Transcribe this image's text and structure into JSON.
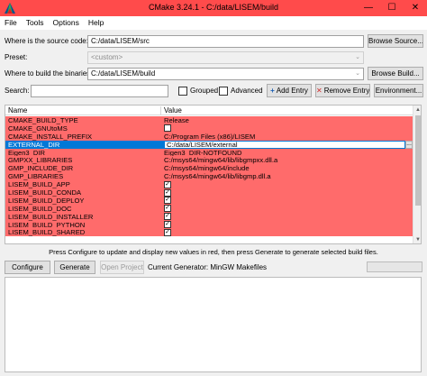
{
  "window": {
    "title": "CMake 3.24.1 - C:/data/LISEM/build",
    "controls": [
      "—",
      "☐",
      "✕"
    ]
  },
  "menu": [
    "File",
    "Tools",
    "Options",
    "Help"
  ],
  "source": {
    "label": "Where is the source code:",
    "value": "C:/data/LISEM/src",
    "browse": "Browse Source..."
  },
  "preset": {
    "label": "Preset:",
    "value": "<custom>"
  },
  "binaries": {
    "label": "Where to build the binaries:",
    "value": "C:/data/LISEM/build",
    "browse": "Browse Build..."
  },
  "search": {
    "label": "Search:",
    "value": "",
    "grouped": "Grouped",
    "advanced": "Advanced",
    "add_entry": "Add Entry",
    "remove_entry": "Remove Entry",
    "environment": "Environment..."
  },
  "table": {
    "headers": {
      "name": "Name",
      "value": "Value"
    },
    "rows": [
      {
        "name": "CMAKE_BUILD_TYPE",
        "value": "Release"
      },
      {
        "name": "CMAKE_GNUtoMS",
        "value": "",
        "checkbox": false
      },
      {
        "name": "CMAKE_INSTALL_PREFIX",
        "value": "C:/Program Files (x86)/LISEM"
      },
      {
        "name": "EXTERNAL_DIR",
        "value": "C:/data/LISEM/external",
        "selected": true
      },
      {
        "name": "Eigen3_DIR",
        "value": "Eigen3_DIR-NOTFOUND"
      },
      {
        "name": "GMPXX_LIBRARIES",
        "value": "C:/msys64/mingw64/lib/libgmpxx.dll.a"
      },
      {
        "name": "GMP_INCLUDE_DIR",
        "value": "C:/msys64/mingw64/include"
      },
      {
        "name": "GMP_LIBRARIES",
        "value": "C:/msys64/mingw64/lib/libgmp.dll.a"
      },
      {
        "name": "LISEM_BUILD_APP",
        "value": "",
        "checkbox": true
      },
      {
        "name": "LISEM_BUILD_CONDA",
        "value": "",
        "checkbox": true
      },
      {
        "name": "LISEM_BUILD_DEPLOY",
        "value": "",
        "checkbox": true
      },
      {
        "name": "LISEM_BUILD_DOC",
        "value": "",
        "checkbox": true
      },
      {
        "name": "LISEM_BUILD_INSTALLER",
        "value": "",
        "checkbox": true
      },
      {
        "name": "LISEM_BUILD_PYTHON",
        "value": "",
        "checkbox": true
      },
      {
        "name": "LISEM_BUILD_SHARED",
        "value": "",
        "checkbox": true
      }
    ]
  },
  "hint": "Press Configure to update and display new values in red, then press Generate to generate selected build files.",
  "actions": {
    "configure": "Configure",
    "generate": "Generate",
    "open_project": "Open Project",
    "generator": "Current Generator: MinGW Makefiles"
  },
  "colors": {
    "titlebar": "#ff4b4b",
    "changed_row": "#ff6b6b",
    "selection": "#0078d7"
  }
}
